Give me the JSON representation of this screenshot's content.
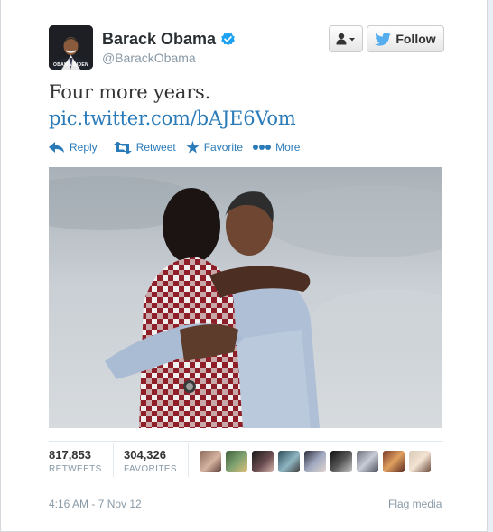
{
  "user": {
    "name": "Barack Obama",
    "handle": "@BarackObama",
    "avatar_caption": "OBAMA BIDEN"
  },
  "buttons": {
    "follow_label": "Follow"
  },
  "tweet": {
    "text": "Four more years.",
    "link": "pic.twitter.com/bAJE6Vom"
  },
  "actions": {
    "reply": "Reply",
    "retweet": "Retweet",
    "favorite": "Favorite",
    "more": "More"
  },
  "stats": {
    "retweets_count": "817,853",
    "retweets_label": "RETWEETS",
    "favorites_count": "304,326",
    "favorites_label": "FAVORITES"
  },
  "footer": {
    "timestamp": "4:16 AM - 7 Nov 12",
    "flag": "Flag media"
  },
  "colors": {
    "link": "#2b7bb9",
    "follow_bird": "#55acee",
    "verified": "#1da1f2"
  }
}
